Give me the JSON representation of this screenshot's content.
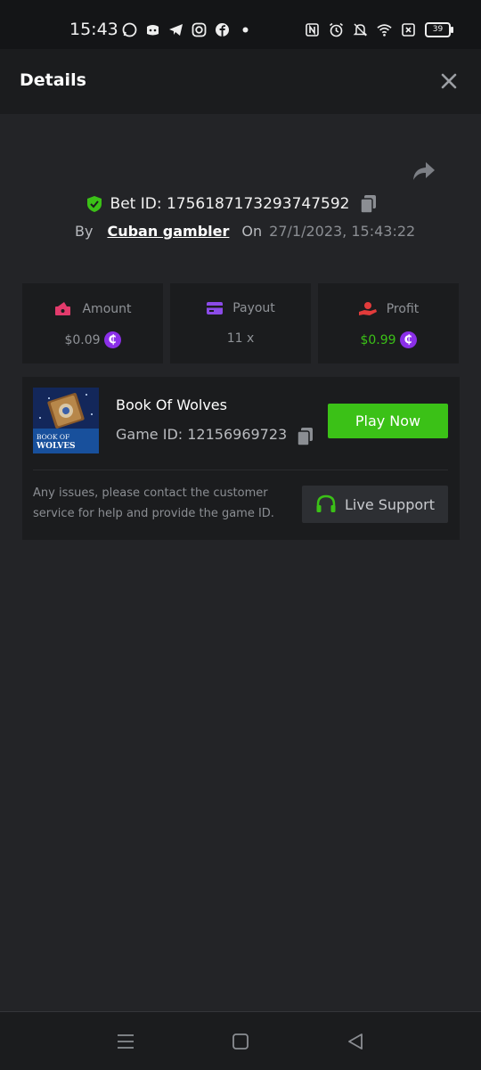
{
  "status_bar": {
    "time": "15:43",
    "battery": "39",
    "left_icons": [
      "whatsapp-icon",
      "discord-icon",
      "telegram-icon",
      "instagram-icon",
      "facebook-icon",
      "dot-icon"
    ],
    "right_icons": [
      "nfc-icon",
      "alarm-icon",
      "bell-off-icon",
      "wifi-icon",
      "close-box-icon",
      "battery-icon"
    ]
  },
  "header": {
    "title": "Details"
  },
  "bet": {
    "id_label": "Bet ID: 1756187173293747592",
    "by_label": "By",
    "user": "Cuban gambler",
    "on_label": "On",
    "date": "27/1/2023, 15:43:22"
  },
  "stats": [
    {
      "label": "Amount",
      "value": "$0.09",
      "color": "#8f9297",
      "icon": "money-icon",
      "icon_color": "#e23b6c"
    },
    {
      "label": "Payout",
      "value": "11 x",
      "color": "#8f9297",
      "icon": "card-icon",
      "icon_color": "#8b4be8"
    },
    {
      "label": "Profit",
      "value": "$0.99",
      "color": "#3bc117",
      "icon": "hand-coin-icon",
      "icon_color": "#e23b3b"
    }
  ],
  "coin_symbol": "₵",
  "game": {
    "name": "Book Of Wolves",
    "id_label": "Game ID: 12156969723",
    "thumb_text": "BOOK OF WOLVES",
    "play_label": "Play Now",
    "help_text": "Any issues, please contact the customer service for help and provide the game ID.",
    "support_label": "Live Support"
  },
  "colors": {
    "accent_green": "#3bc117",
    "coin_purple": "#8b2fe8",
    "background": "#232427"
  }
}
